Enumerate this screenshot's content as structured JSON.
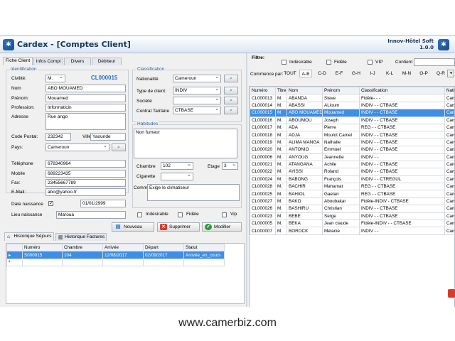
{
  "window": {
    "title": "Cardex - [Comptes Client]",
    "brand_line1": "Innov-Hôtel Soft",
    "brand_line2": "1.0.0"
  },
  "tabs": [
    "Fiche Client",
    "Infos Compl",
    "Divers",
    "Débiteur"
  ],
  "identification": {
    "group_title": "Identification",
    "civilite_label": "Civilité:",
    "civilite_value": "M.",
    "client_code": "CL000015",
    "nom_label": "Nom",
    "nom_value": "ABO MOUAMED",
    "prenom_label": "Prénom:",
    "prenom_value": "Mouamed",
    "profession_label": "Profession:",
    "profession_value": "Informaticin",
    "adresse_label": "Adresse",
    "adresse_value": "Rue ango",
    "code_postal_label": "Code Postal:",
    "code_postal_value": "232342",
    "ville_label": "Ville",
    "ville_value": "Yaounde",
    "pays_label": "Pays:",
    "pays_value": "Cameroun",
    "telephone_label": "Téléphone",
    "telephone_value": "678340964",
    "mobile_label": "Mobile",
    "mobile_value": "689223435",
    "fax_label": "Fax:",
    "fax_value": "23455667789",
    "email_label": "E-Mail:",
    "email_value": "abo@yahoo.fr",
    "date_naissance_label": "Date naissance",
    "date_naissance_value": "01/01/2999",
    "lieu_naissance_label": "Lieu  naissance",
    "lieu_naissance_value": "Maroua"
  },
  "classification": {
    "group_title": "Classification",
    "nationalite_label": "Nationalité",
    "nationalite_value": "Cameroun",
    "type_client_label": "Type de client:",
    "type_client_value": "INDIV",
    "societe_label": "Société",
    "societe_value": "",
    "contrat_label": "Contrat Tarifaire",
    "contrat_value": "CTBASE"
  },
  "habitudes": {
    "group_title": "Habitudes",
    "text": "Non fumeur",
    "chambre_label": "Chambre",
    "chambre_value": "102",
    "etage_label": "Etage",
    "etage_value": "3",
    "cigarette_label": "Cigarette",
    "cigarette_value": "",
    "comm_label": "Comm.",
    "comm_value": "Exige le climatiseur",
    "indesirable_label": "Indésirable",
    "fidele_label": "Fidèle",
    "vip_label": "Vip"
  },
  "actions": {
    "nouveau": "Nouveau",
    "supprimer": "Supprimer",
    "modifier": "Modifier"
  },
  "bottom_tabs": [
    "Historique Séjours",
    "Historique Factures"
  ],
  "sejours": {
    "columns": [
      "Numéro",
      "Chambre",
      "Arrivée",
      "Départ",
      "Statut"
    ],
    "rows": [
      [
        "S000015",
        "104",
        "12/08/2017",
        "02/09/2017",
        "Arrivée_en_cours"
      ]
    ]
  },
  "filter": {
    "label": "Filtre:",
    "indesirable": "Indésirable",
    "fidele": "Fidèle",
    "vip": "VIP",
    "contient": "Contient",
    "commence_par": "Commence par:",
    "letters": [
      "TOUT",
      "A-B",
      "C-D",
      "E-F",
      "G-H",
      "I-J",
      "K-L",
      "M-N",
      "O-P",
      "Q-R"
    ]
  },
  "clients": {
    "columns": [
      "Numéro",
      "Titre",
      "Nom",
      "Prénom",
      "Classification",
      "Natio"
    ],
    "rows": [
      [
        "CL000013",
        "M.",
        "ABANDA",
        "Steve",
        "Fidèle- - -",
        "Came"
      ],
      [
        "CL000014",
        "M.",
        "ABASSI",
        "ALioum",
        "INDIV - - CTBASE",
        "Came"
      ],
      [
        "CL000015",
        "M.",
        "ABO MOUAMED",
        "Mouamed",
        "INDIV - - CTBASE",
        "Came"
      ],
      [
        "CL000016",
        "M.",
        "ABOUMOU",
        "Joseph",
        "INDIV - - CTBASE",
        "Came"
      ],
      [
        "CL000017",
        "M.",
        "ADA",
        "Pierre",
        "REG - - CTBASE",
        "Came"
      ],
      [
        "CL000018",
        "M.",
        "ADJA",
        "Moulot Camel",
        "INDIV - - CTBASE",
        "Came"
      ],
      [
        "CL000019",
        "M.",
        "ALIMA MANGA",
        "Nathalie",
        "INDIV - - CTBASE",
        "Came"
      ],
      [
        "CL000020",
        "M.",
        "ANTONIO",
        "Emmuel",
        "INDIV - - CTBASE",
        "Came"
      ],
      [
        "CL000006",
        "M.",
        "ANYOUG",
        "Jeannette",
        "INDIV - -",
        "Came"
      ],
      [
        "CL000021",
        "M.",
        "ATANGANA",
        "Achile",
        "INDIV - - CTBASE",
        "Came"
      ],
      [
        "CL000022",
        "M.",
        "AYISSI",
        "Roland",
        "INDIV - - CTBASE",
        "Came"
      ],
      [
        "CL000024",
        "M.",
        "BABONG",
        "François",
        "INDIV - - CTREGUL",
        "Came"
      ],
      [
        "CL000028",
        "M.",
        "BACHIR",
        "Mahamat",
        "REG - - CTBASE",
        "Came"
      ],
      [
        "CL000025",
        "M.",
        "BAHIOL",
        "Gaetan",
        "REG - - CTBASE",
        "Came"
      ],
      [
        "CL000027",
        "M.",
        "BAKO",
        "Aboubakar",
        "Fidèle-INDIV - CTBASE",
        "Came"
      ],
      [
        "CL000026",
        "M.",
        "BASHIRU",
        "Christian",
        "INDIV - - CTBASE",
        "Came"
      ],
      [
        "CL000023",
        "M.",
        "BEBE",
        "Serge",
        "INDIV - - CTBASE",
        "Came"
      ],
      [
        "CL000005",
        "M.",
        "BEKA",
        "Jean claude",
        "Fidèle-INDIV - - CTBASE",
        "Came"
      ],
      [
        "CL000007",
        "M.",
        "BOROCK",
        "Melanie",
        "INDIV - -",
        "Came"
      ]
    ]
  },
  "footer_url": "www.camerbiz.com",
  "colors": {
    "selection": "#3d8ee6",
    "title": "#13345d",
    "group_title": "#2b5fa8"
  }
}
